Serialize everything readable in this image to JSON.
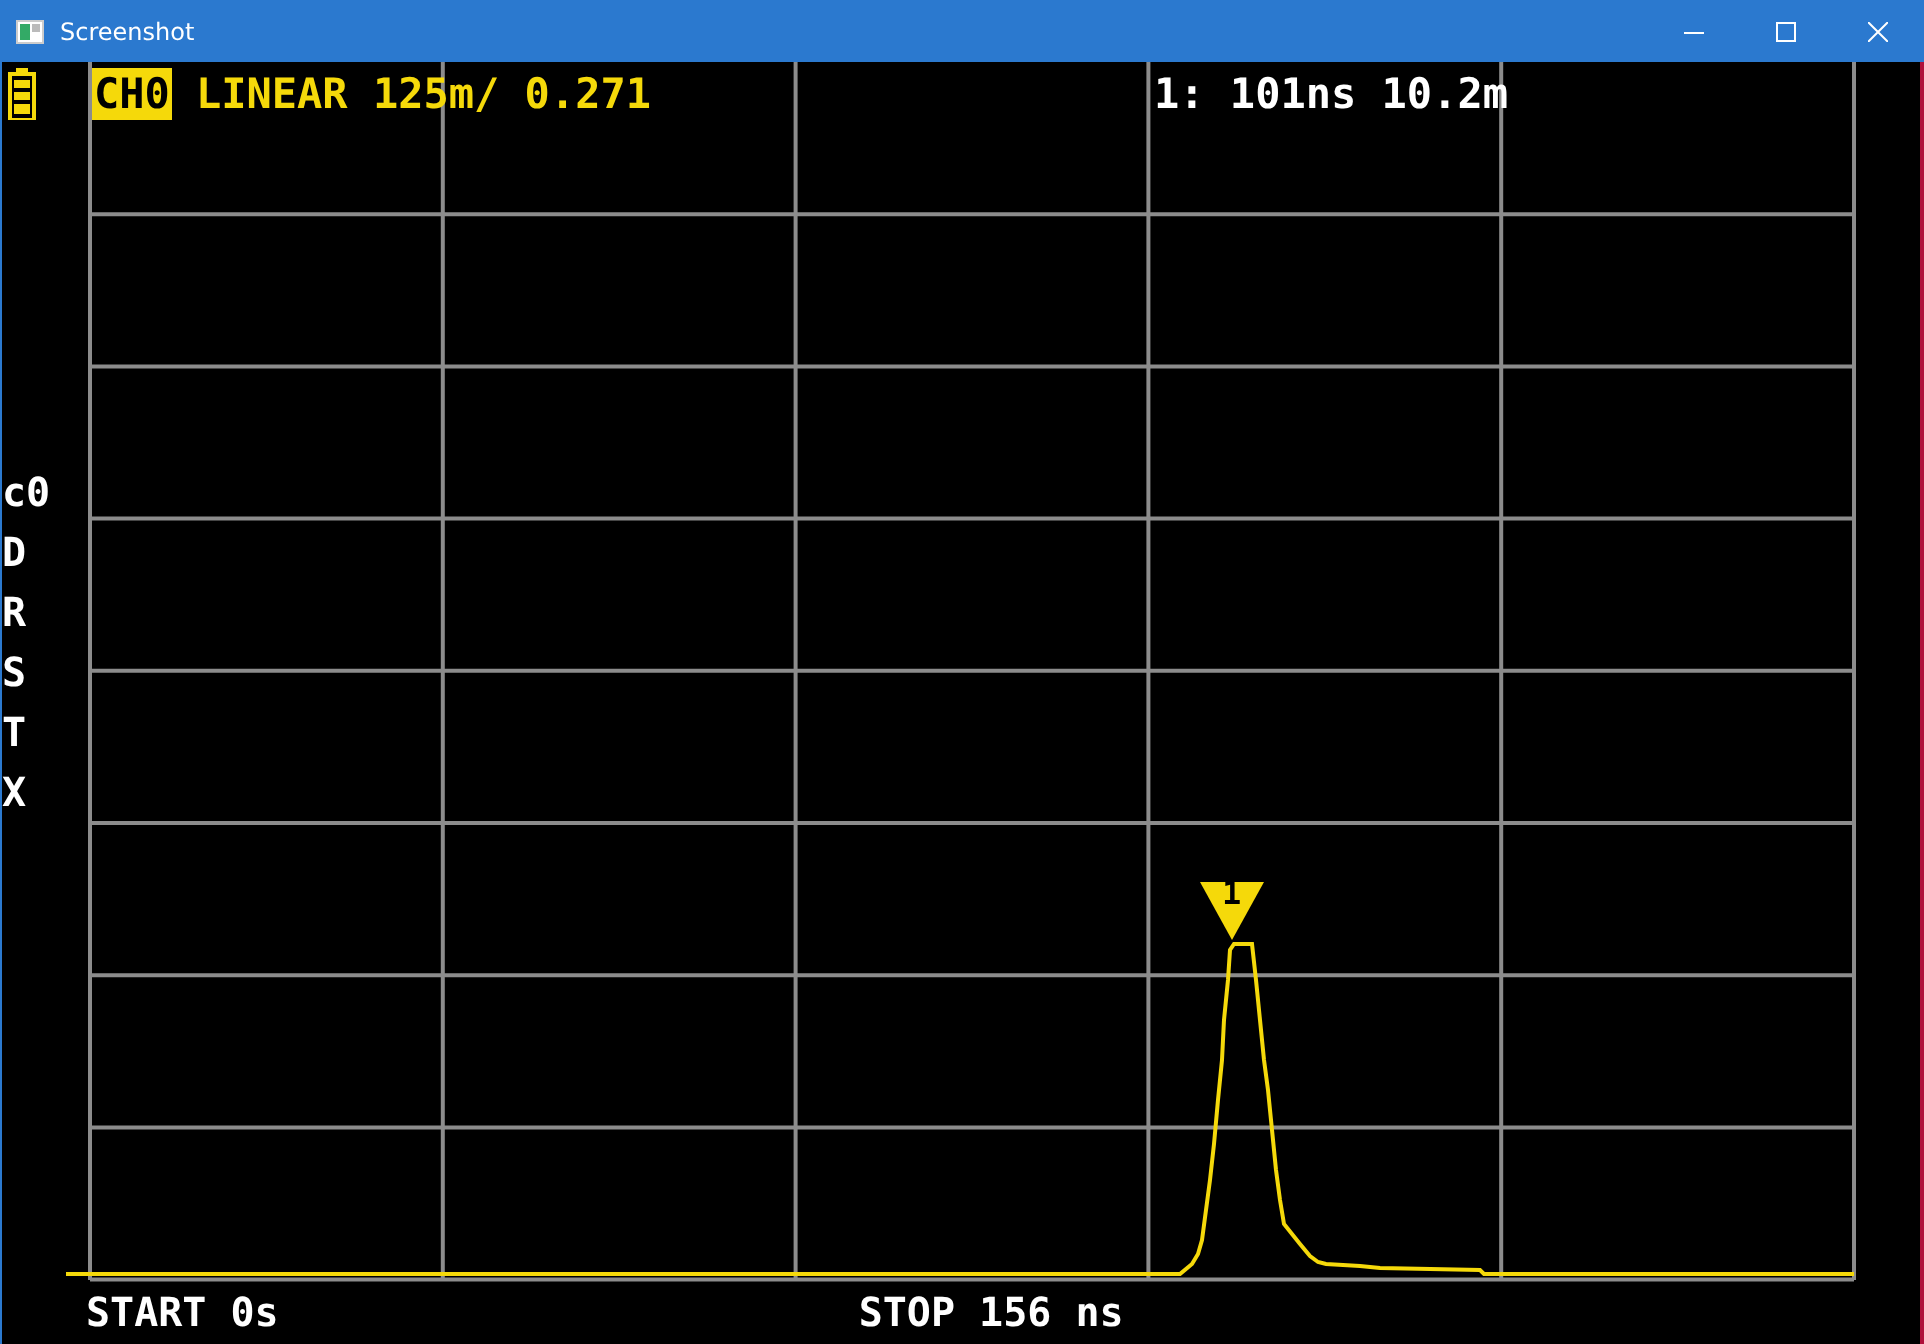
{
  "window": {
    "title": "Screenshot"
  },
  "header": {
    "channel": {
      "label": "CH0",
      "active": true
    },
    "format": "LINEAR 125m/ 0.271",
    "marker_readout": "1: 101ns 10.2m"
  },
  "side_labels": [
    "c0",
    "D",
    "R",
    "S",
    "T",
    "X"
  ],
  "markers": [
    {
      "label": "1"
    }
  ],
  "footer": {
    "start": "START 0s",
    "stop": "STOP 156 ns"
  }
}
